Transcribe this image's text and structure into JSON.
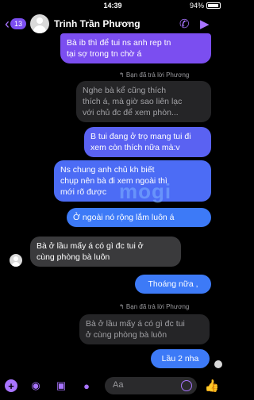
{
  "status": {
    "time": "14:39",
    "battery": "94%"
  },
  "header": {
    "back_count": "13",
    "name": "Trinh Trần Phương"
  },
  "messages": [
    {
      "text1": "Bà ib thì để tui ns anh rep tn",
      "text2": "tại sợ trong tn chờ á"
    },
    {
      "reply_label": "↰ Bạn đã trả lời Phương"
    },
    {
      "text1": "Nghe bà kể cũng thích",
      "text2": "thích á, mà giờ sao liên lạc",
      "text3": "với chủ đc để xem phòn..."
    },
    {
      "text1": "B tui đang ở trọ mang tui đi",
      "text2": "xem còn thích nữa mà:v"
    },
    {
      "text1": "Ns chung anh chủ kh biết",
      "text2": "chụp nên bà đi xem ngoài thì",
      "text3": "mới rõ được"
    },
    {
      "text1": "Ở ngoài nó rộng lắm luôn á"
    },
    {
      "text1": "Bà ở lầu mấy á có gì đc tui ở",
      "text2": "cùng phòng bà luôn"
    },
    {
      "text1": "Thoáng nữa ,"
    },
    {
      "reply_label": "↰ Bạn đã trả lời Phương"
    },
    {
      "text1": "Bà ở lầu mấy á có gì đc tui",
      "text2": "ở cùng phòng bà luôn"
    },
    {
      "text1": "Lầu 2 nha"
    }
  ],
  "watermark": "mogi",
  "composer": {
    "placeholder": "Aa"
  },
  "icons": {
    "back": "chevron-left-icon",
    "call": "phone-icon",
    "video": "video-icon",
    "add": "plus-icon",
    "camera": "camera-icon",
    "gallery": "image-icon",
    "mic": "mic-icon",
    "emoji": "smile-icon",
    "like": "thumbs-up-icon"
  },
  "colors": {
    "accent": "#a874ff",
    "outgoing": "#7b4ef0",
    "outgoing_blue": "#3d7af7",
    "incoming": "#3a3a3c"
  }
}
